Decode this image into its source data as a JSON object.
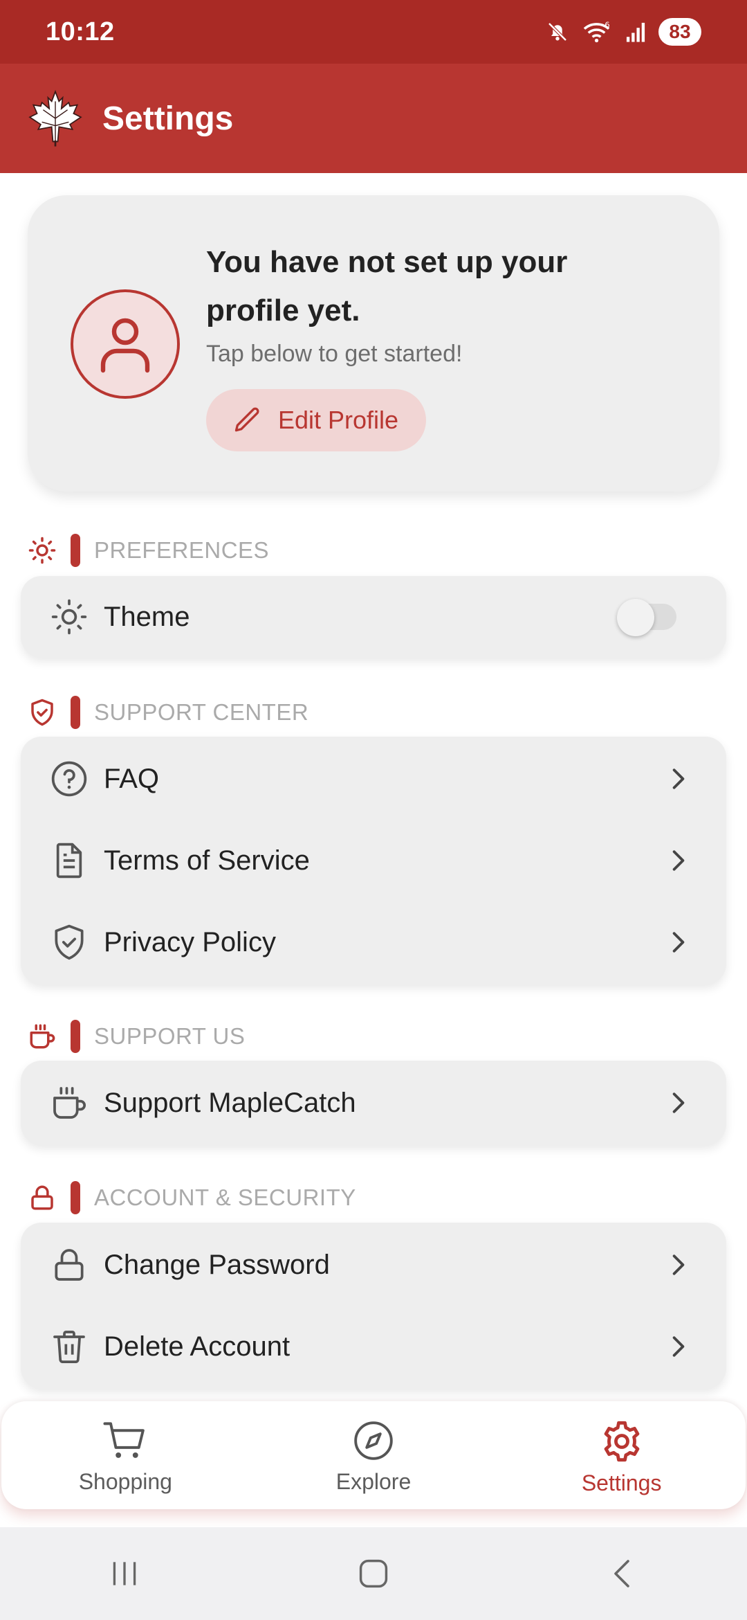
{
  "status_bar": {
    "time": "10:12",
    "battery": "83"
  },
  "app_bar": {
    "title": "Settings"
  },
  "profile": {
    "title": "You have not set up your profile yet.",
    "subtitle": "Tap below to get started!",
    "edit_label": "Edit Profile"
  },
  "sections": {
    "preferences": {
      "label": "PREFERENCES",
      "icon": "sun-icon",
      "items": [
        {
          "label": "Theme",
          "icon": "sun-icon",
          "toggle_on": false
        }
      ]
    },
    "support_center": {
      "label": "SUPPORT CENTER",
      "icon": "shield-check-icon",
      "items": [
        {
          "label": "FAQ",
          "icon": "help-circle-icon"
        },
        {
          "label": "Terms of Service",
          "icon": "document-icon"
        },
        {
          "label": "Privacy Policy",
          "icon": "shield-check-icon"
        }
      ]
    },
    "support_us": {
      "label": "SUPPORT US",
      "icon": "coffee-icon",
      "items": [
        {
          "label": "Support MapleCatch",
          "icon": "coffee-icon"
        }
      ]
    },
    "account": {
      "label": "ACCOUNT & SECURITY",
      "icon": "lock-icon",
      "items": [
        {
          "label": "Change Password",
          "icon": "lock-icon"
        },
        {
          "label": "Delete Account",
          "icon": "trash-icon"
        }
      ]
    }
  },
  "bottom_nav": {
    "items": [
      {
        "label": "Shopping",
        "icon": "cart-icon",
        "active": false
      },
      {
        "label": "Explore",
        "icon": "compass-icon",
        "active": false
      },
      {
        "label": "Settings",
        "icon": "gear-icon",
        "active": true
      }
    ]
  },
  "colors": {
    "accent": "#b83631",
    "status_bar": "#a92a25",
    "card": "#eeeeee"
  }
}
